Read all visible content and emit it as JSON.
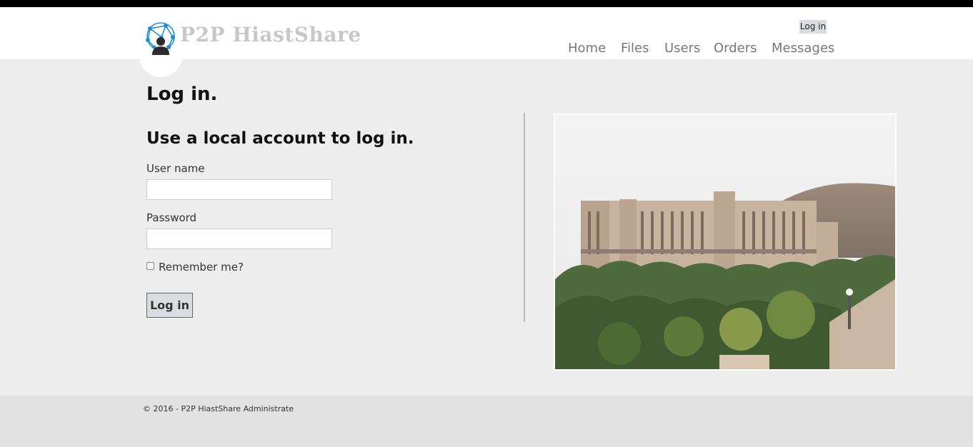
{
  "header": {
    "brand": "P2P HiastShare",
    "login_link": "Log in",
    "nav": [
      "Home",
      "Files",
      "Users",
      "Orders",
      "Messages"
    ],
    "logo_icon": "network-user-icon"
  },
  "main": {
    "title": "Log in.",
    "subtitle": "Use a local account to log in.",
    "username_label": "User name",
    "username_value": "",
    "password_label": "Password",
    "password_value": "",
    "remember_label": "Remember me?",
    "remember_checked": false,
    "submit_label": "Log in"
  },
  "footer": {
    "copyright": "© 2016 - P2P HiastShare Administrate"
  },
  "colors": {
    "page_bg": "#ededed",
    "header_bg": "#ffffff",
    "brand_text": "#c8c8c8",
    "nav_text": "#777777",
    "logo_blue": "#1e8fd6",
    "button_bg": "#d9dde1"
  }
}
